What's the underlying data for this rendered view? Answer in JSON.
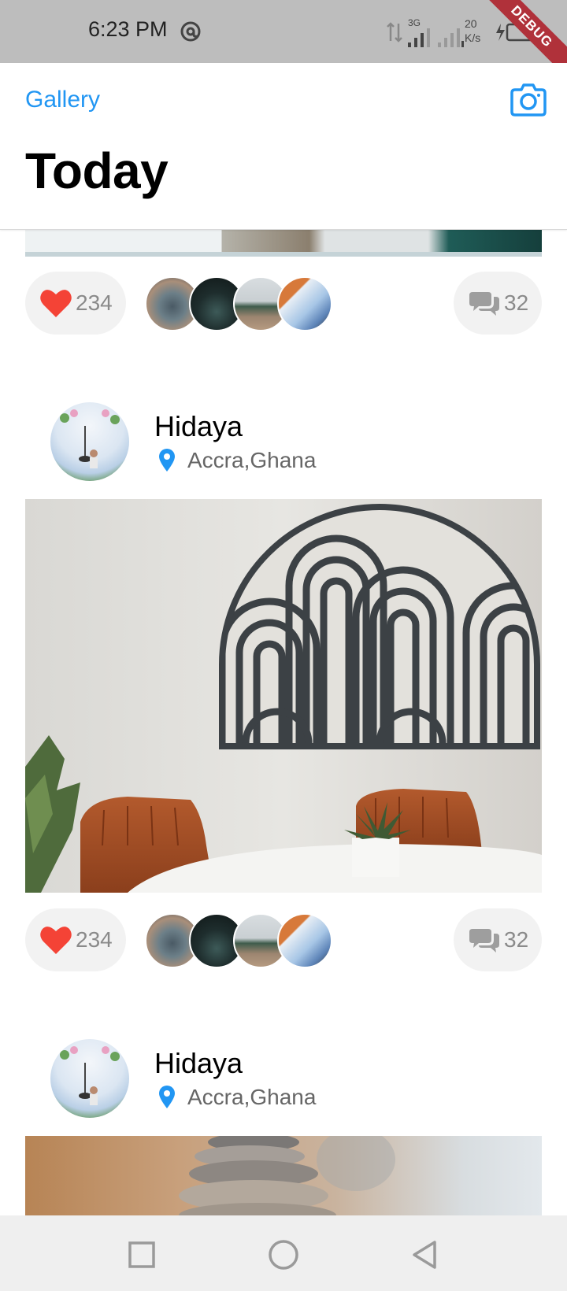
{
  "status_bar": {
    "time": "6:23 PM",
    "network_type": "3G",
    "speed_value": "20",
    "speed_unit": "K/s",
    "debug_label": "DEBUG"
  },
  "header": {
    "gallery_label": "Gallery",
    "title": "Today"
  },
  "colors": {
    "accent": "#2196f3",
    "like": "#f44336",
    "pill_bg": "#f2f2f2",
    "muted_text": "#8a8a8a"
  },
  "feed": {
    "posts": [
      {
        "likes": "234",
        "comments": "32"
      },
      {
        "author": "Hidaya",
        "location": "Accra,Ghana",
        "likes": "234",
        "comments": "32"
      },
      {
        "author": "Hidaya",
        "location": "Accra,Ghana"
      }
    ]
  },
  "icons": {
    "camera": "camera-icon",
    "heart": "heart-icon",
    "comment": "comment-icon",
    "location": "location-pin-icon",
    "nav_recent": "square-icon",
    "nav_home": "circle-icon",
    "nav_back": "triangle-back-icon"
  }
}
